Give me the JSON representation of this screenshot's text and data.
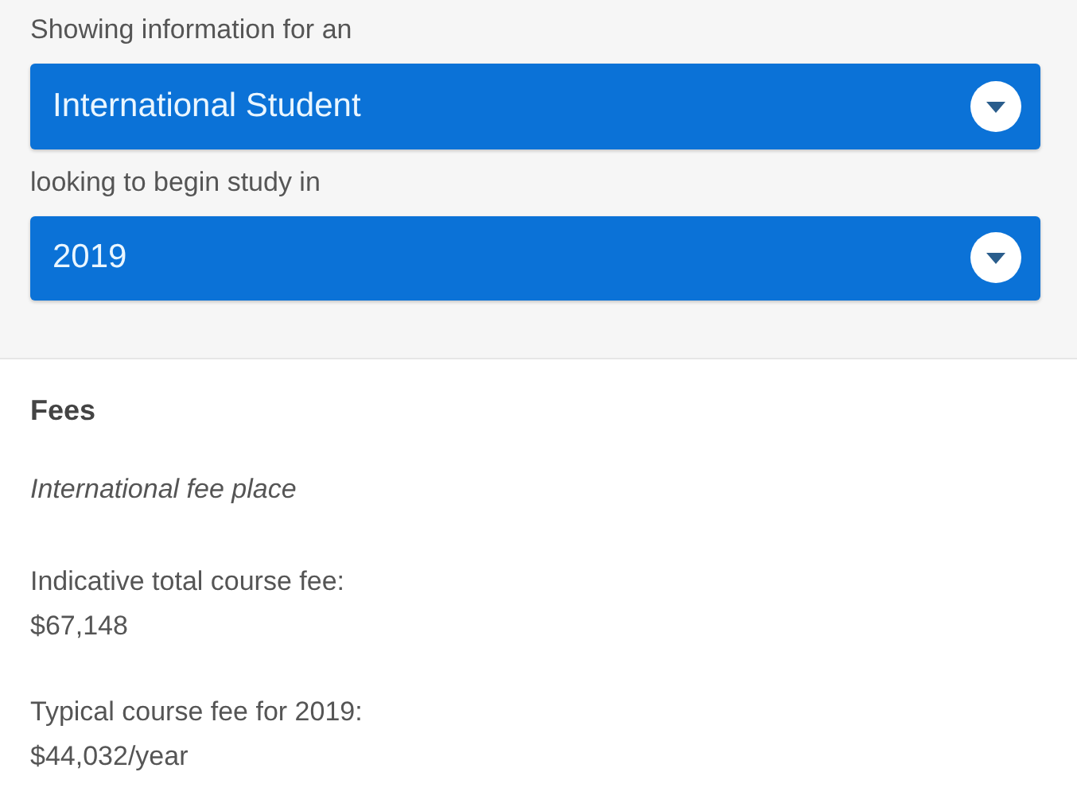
{
  "filters": [
    {
      "label": "Showing information for an",
      "value": "International Student"
    },
    {
      "label": "looking to begin study in",
      "value": "2019"
    }
  ],
  "fees": {
    "heading": "Fees",
    "note": "International fee place",
    "items": [
      {
        "label": "Indicative total course fee:",
        "value": "$67,148"
      },
      {
        "label": "Typical course fee for 2019:",
        "value": "$44,032/year"
      }
    ]
  }
}
